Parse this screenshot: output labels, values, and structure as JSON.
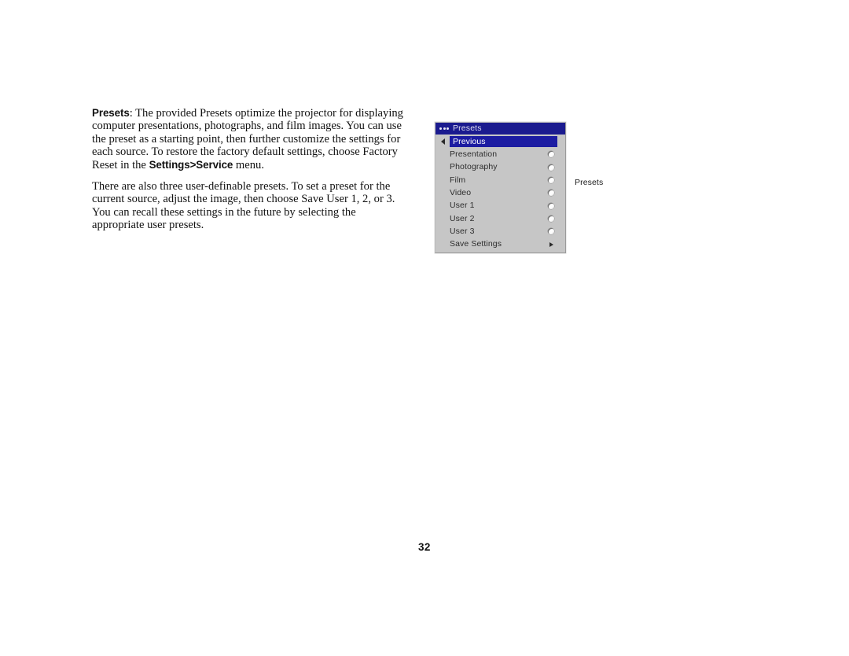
{
  "document": {
    "page_number": "32",
    "paragraphs": [
      {
        "id": "p1",
        "segments": [
          {
            "text": "Presets",
            "bold": true
          },
          {
            "text": ": The provided Presets optimize the projector for displaying computer presentations, photographs, and film images. You can use the preset as a starting point, then further customize the settings for each source. To restore the factory default settings, choose Factory Reset in the ",
            "bold": false
          },
          {
            "text": "Settings>Service",
            "bold": true
          },
          {
            "text": " menu.",
            "bold": false
          }
        ],
        "plain": "Presets: The provided Presets optimize the projector for displaying computer presentations, photographs, and film images. You can use the preset as a starting point, then further customize the settings for each source. To restore the factory default settings, choose Factory Reset in the Settings>Service menu."
      },
      {
        "id": "p2",
        "segments": [
          {
            "text": "There are also three user-definable presets. To set a preset for the current source, adjust the image, then choose Save User 1, 2, or 3. You can recall these settings in the future by selecting the appropriate user presets.",
            "bold": false
          }
        ],
        "plain": "There are also three user-definable presets. To set a preset for the current source, adjust the image, then choose Save User 1, 2, or 3. You can recall these settings in the future by selecting the appropriate user presets."
      }
    ]
  },
  "osd_menu": {
    "title": "Presets",
    "title_dots_count": 3,
    "colors": {
      "title_bar": "#1b1b8f",
      "highlight": "#1c1ca2",
      "body": "#c6c6c6",
      "title_text": "#dcdcf0",
      "item_text": "#2e2e2e"
    },
    "back_item": {
      "label": "Previous",
      "highlighted": true,
      "icon": "left-triangle-icon"
    },
    "items": [
      {
        "label": "Presentation",
        "control": "radio",
        "selected": false
      },
      {
        "label": "Photography",
        "control": "radio",
        "selected": false
      },
      {
        "label": "Film",
        "control": "radio",
        "selected": false
      },
      {
        "label": "Video",
        "control": "radio",
        "selected": false
      },
      {
        "label": "User 1",
        "control": "radio",
        "selected": false
      },
      {
        "label": "User 2",
        "control": "radio",
        "selected": false
      },
      {
        "label": "User 3",
        "control": "radio",
        "selected": false
      },
      {
        "label": "Save Settings",
        "control": "submenu",
        "selected": false
      }
    ]
  },
  "caption": {
    "text": "Presets"
  }
}
